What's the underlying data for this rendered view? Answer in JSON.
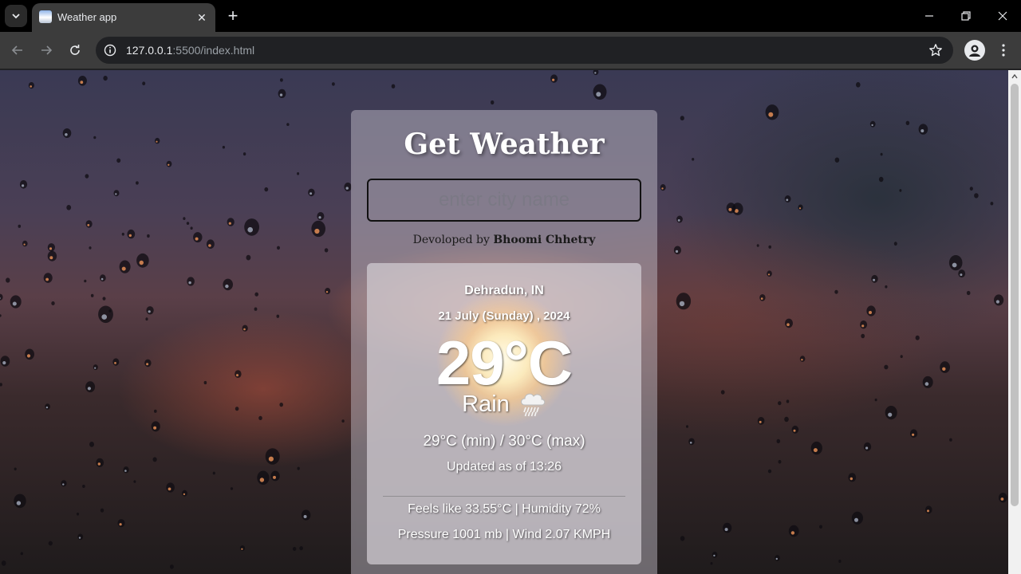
{
  "browser": {
    "tab_title": "Weather app",
    "url_host": "127.0.0.1",
    "url_path": ":5500/index.html"
  },
  "app": {
    "title": "Get Weather",
    "search": {
      "placeholder": "enter city name",
      "value": ""
    },
    "credit_prefix": "Devoloped by ",
    "credit_name": "Bhoomi Chhetry"
  },
  "weather": {
    "city": "Dehradun, IN",
    "date": "21 July (Sunday) , 2024",
    "temperature": "29°C",
    "condition": "Rain",
    "condition_icon": "rain-cloud-icon",
    "min_max": "29°C (min) / 30°C (max)",
    "updated": "Updated as of 13:26",
    "feels_humidity": "Feels like 33.55°C | Humidity 72%",
    "pressure_wind": "Pressure 1001 mb | Wind 2.07 KMPH"
  },
  "colors": {
    "chrome_dark": "#000000",
    "toolbar": "#3c3c3c",
    "omnibox": "#202124",
    "text_light": "#e8eaed"
  }
}
